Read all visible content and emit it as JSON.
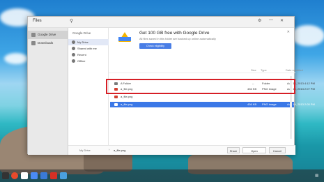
{
  "window": {
    "title": "Files",
    "search_icon": "search-icon"
  },
  "left_nav": {
    "items": [
      {
        "label": "Google Drive",
        "icon": "drive-icon",
        "selected": true
      },
      {
        "label": "Downloads",
        "icon": "download-icon",
        "selected": false
      }
    ]
  },
  "drive_nav": {
    "header": "Google Drive",
    "items": [
      {
        "label": "My Drive",
        "selected": true
      },
      {
        "label": "Shared with me",
        "selected": false
      },
      {
        "label": "Recent",
        "selected": false
      },
      {
        "label": "Offline",
        "selected": false
      }
    ]
  },
  "banner": {
    "title": "Get 100 GB free with Google Drive",
    "subtitle": "All files saved in this folder are backed up online automatically",
    "button": "Check eligibility"
  },
  "columns": {
    "size": "Size",
    "type": "Type",
    "date": "Date modified"
  },
  "files": [
    {
      "name": "A Folder",
      "size": "--",
      "type": "Folder",
      "date": "Aug 14, 2013 4:12 PM",
      "kind": "folder",
      "selected": false
    },
    {
      "name": "a_file.png",
      "size": "436 KB",
      "type": "PNG image",
      "date": "Aug 14, 2013 2:07 PM",
      "kind": "image",
      "selected": false
    },
    {
      "name": "a_file.png",
      "size": "",
      "type": "",
      "date": "",
      "kind": "image",
      "selected": false
    },
    {
      "name": "a_file.png",
      "size": "436 KB",
      "type": "PNG image",
      "date": "Aug 14, 2013 2:05 PM",
      "kind": "image",
      "selected": true
    }
  ],
  "footer": {
    "breadcrumb": "My Drive",
    "filename": "a_file.png",
    "share": "Share",
    "open": "Open",
    "cancel": "Cancel"
  },
  "colors": {
    "accent": "#3b78e7",
    "highlight_border": "#d61f26"
  }
}
